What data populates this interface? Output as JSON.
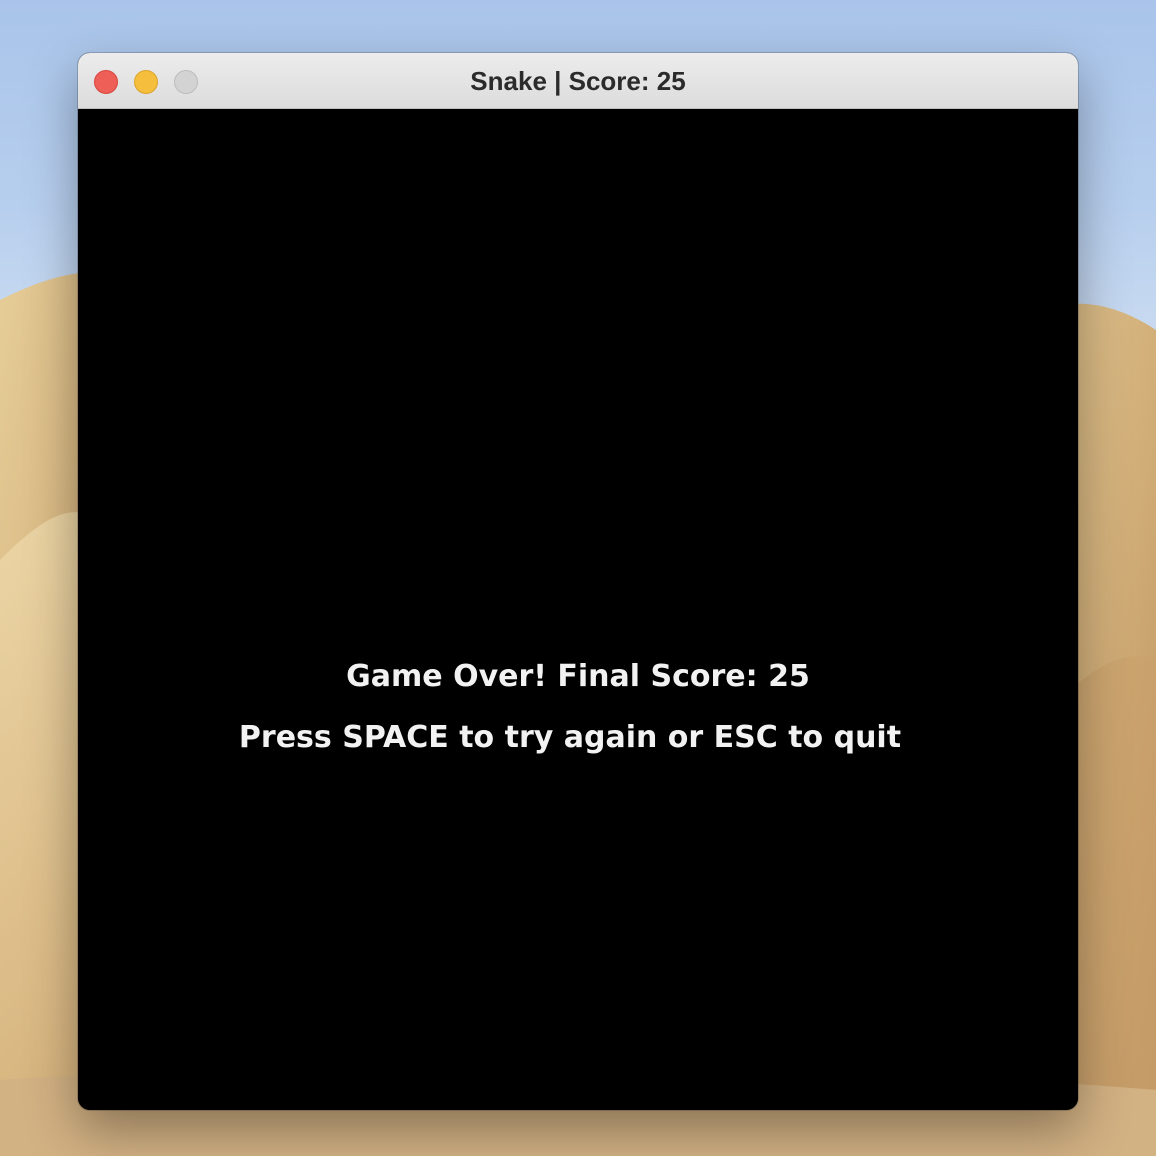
{
  "window": {
    "title": "Snake | Score: 25",
    "controls": [
      {
        "name": "close",
        "color": "#ee5f57"
      },
      {
        "name": "minimize",
        "color": "#f5be3c"
      },
      {
        "name": "zoom",
        "color": "#d3d3d3"
      }
    ]
  },
  "game": {
    "background_color": "#000000",
    "text_color": "#f2f2f2",
    "game_over_message": "Game Over! Final Score: 25",
    "instructions": "Press SPACE to try again or ESC to quit"
  }
}
